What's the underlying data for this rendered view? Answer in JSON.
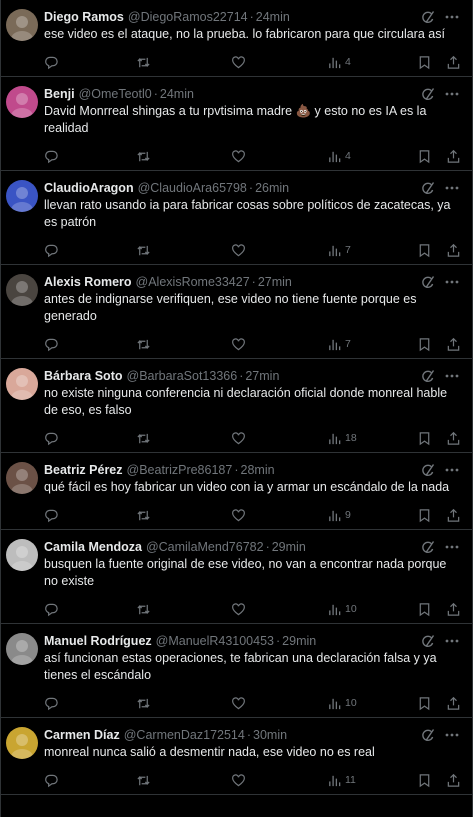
{
  "colors": {
    "background": "#000000",
    "text": "#e7e9ea",
    "muted": "#71767b",
    "divider": "#2f3336"
  },
  "separator": "·",
  "icons": {
    "grok": "grok-icon",
    "more": "more-icon",
    "reply": "reply-icon",
    "retweet": "retweet-icon",
    "like": "heart-icon",
    "views": "views-icon",
    "bookmark": "bookmark-icon",
    "share": "share-icon"
  },
  "tweets": [
    {
      "name": "Diego Ramos",
      "handle": "@DiegoRamos22714",
      "time": "24min",
      "text": "ese video es el ataque, no la prueba. lo fabricaron para que circulara así",
      "views": "4",
      "avatar": "#7a6a58"
    },
    {
      "name": "Benji",
      "handle": "@OmeTeotl0",
      "time": "24min",
      "text": "David Monrreal shingas  a tu rpvtisima madre 💩 y esto no es IA es la realidad",
      "views": "4",
      "avatar": "#c04a8c"
    },
    {
      "name": "ClaudioAragon",
      "handle": "@ClaudioAra65798",
      "time": "26min",
      "text": "llevan rato usando ia para fabricar cosas sobre políticos de zacatecas, ya es patrón",
      "views": "7",
      "avatar": "#3a54c4"
    },
    {
      "name": "Alexis Romero",
      "handle": "@AlexisRome33427",
      "time": "27min",
      "text": "antes de indignarse verifiquen, ese video no tiene fuente porque es generado",
      "views": "7",
      "avatar": "#4a4540"
    },
    {
      "name": "Bárbara Soto",
      "handle": "@BarbaraSot13366",
      "time": "27min",
      "text": "no existe ninguna conferencia ni declaración oficial donde monreal hable de eso, es falso",
      "views": "18",
      "avatar": "#d9a89a"
    },
    {
      "name": "Beatriz Pérez",
      "handle": "@BeatrizPre86187",
      "time": "28min",
      "text": "qué fácil es hoy fabricar un video con ia y armar un escándalo de la nada",
      "views": "9",
      "avatar": "#6b5146"
    },
    {
      "name": "Camila Mendoza",
      "handle": "@CamilaMend76782",
      "time": "29min",
      "text": "busquen la fuente original de ese video, no van a encontrar nada porque no existe",
      "views": "10",
      "avatar": "#bdbdbd"
    },
    {
      "name": "Manuel Rodríguez",
      "handle": "@ManuelR43100453",
      "time": "29min",
      "text": "así funcionan estas operaciones, te fabrican una declaración falsa y ya tienes el escándalo",
      "views": "10",
      "avatar": "#8a8a8a"
    },
    {
      "name": "Carmen Díaz",
      "handle": "@CarmenDaz172514",
      "time": "30min",
      "text": "monreal nunca salió a desmentir nada, ese video no es real",
      "views": "11",
      "avatar": "#c9a531"
    }
  ]
}
